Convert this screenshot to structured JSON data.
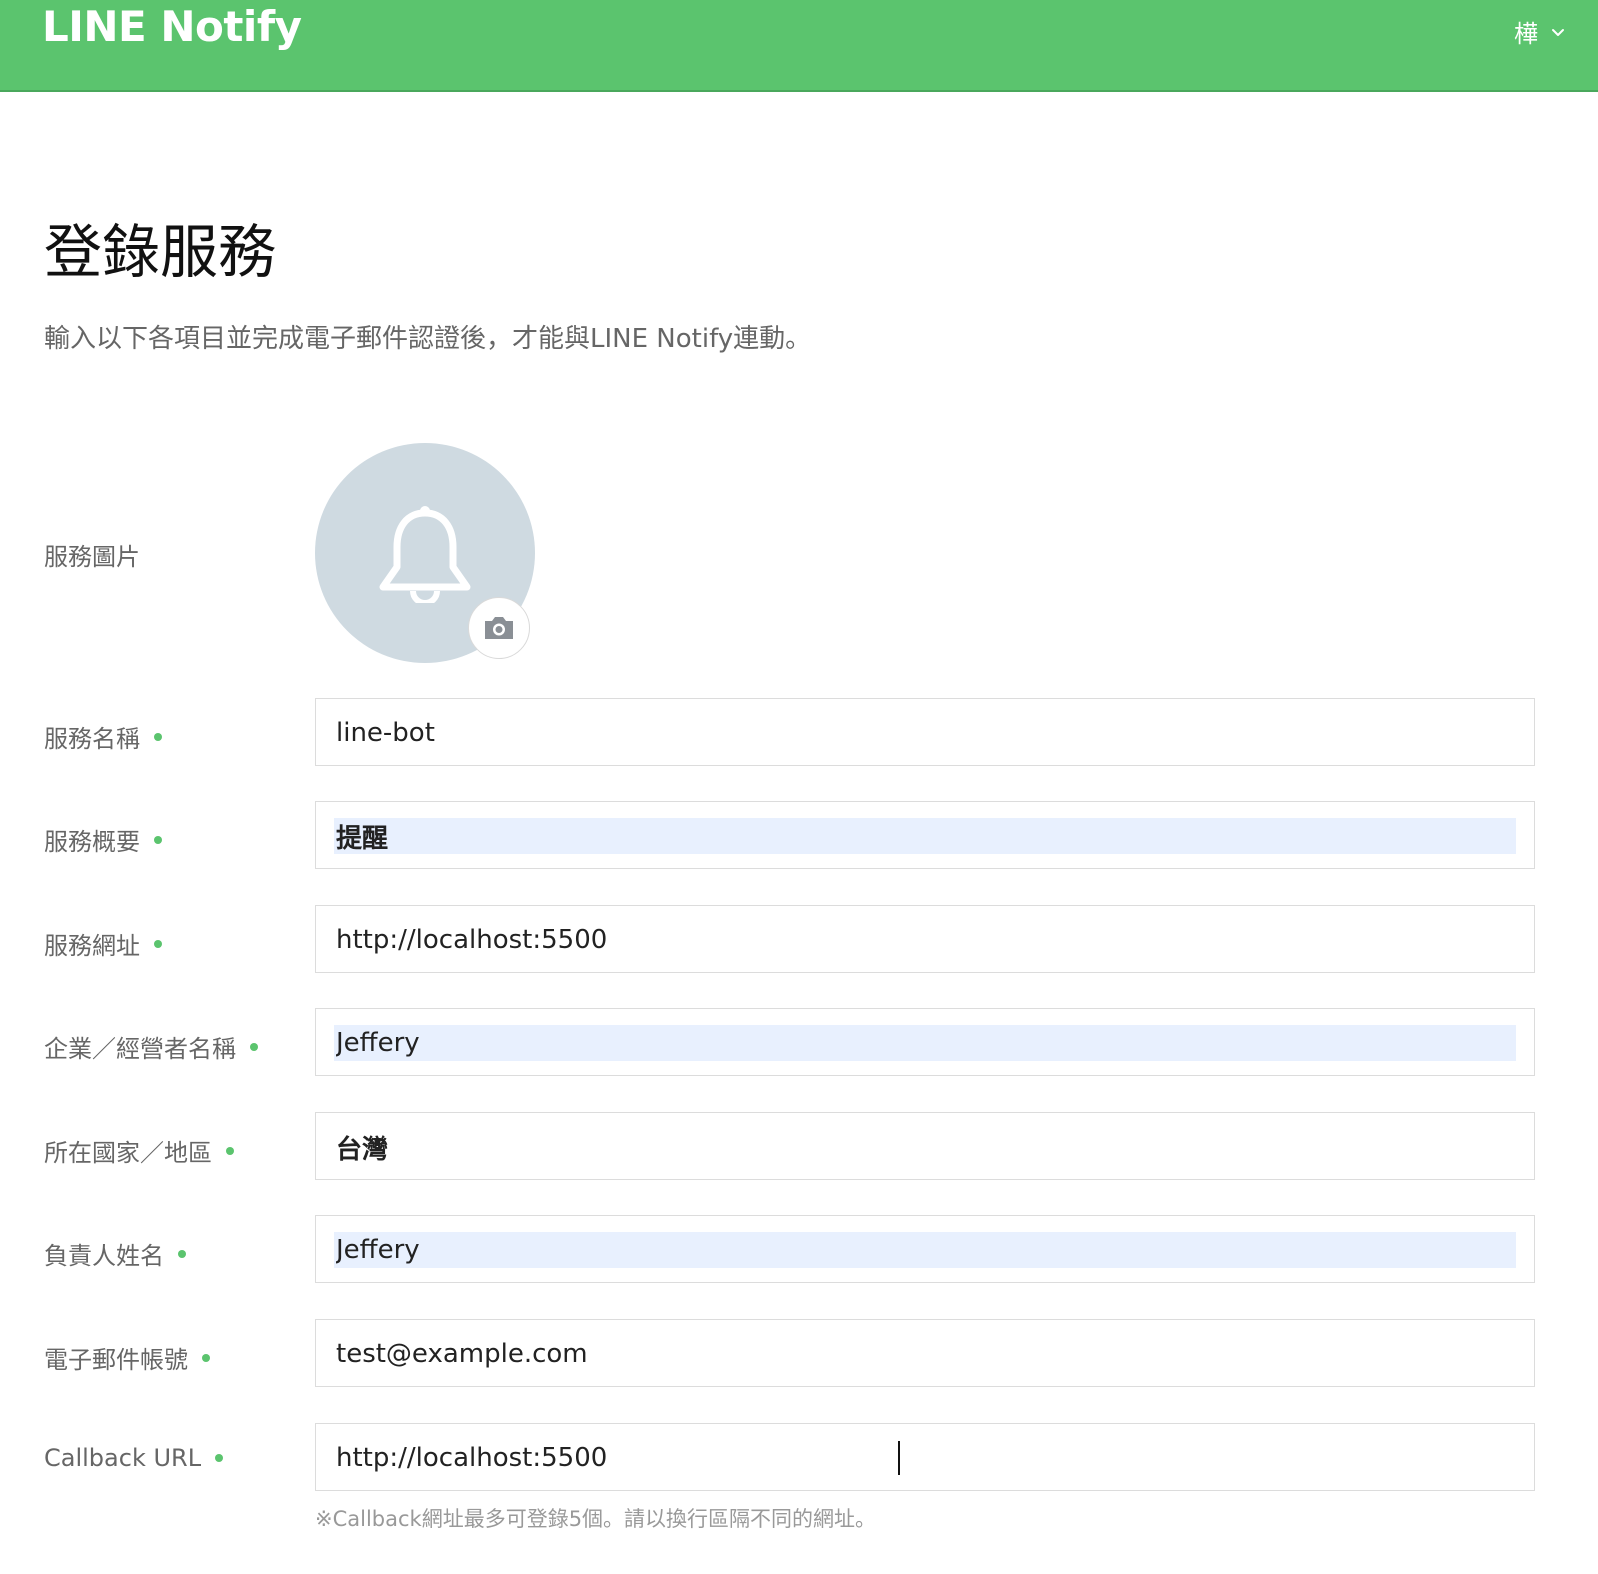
{
  "header": {
    "logo": "LINE Notify",
    "user_name": "樺",
    "brand_color": "#5bc46e"
  },
  "page": {
    "title": "登錄服務",
    "description": "輸入以下各項目並完成電子郵件認證後，才能與LINE Notify連動。"
  },
  "form": {
    "image_label": "服務圖片",
    "avatar_icon": "bell-icon",
    "camera_icon": "camera-icon",
    "fields": [
      {
        "label": "服務名稱",
        "value": "line-bot"
      },
      {
        "label": "服務概要",
        "value": "提醒"
      },
      {
        "label": "服務網址",
        "value": "http://localhost:5500"
      },
      {
        "label": "企業／經營者名稱",
        "value": "Jeffery"
      },
      {
        "label": "所在國家／地區",
        "value": "台灣"
      },
      {
        "label": "負責人姓名",
        "value": "Jeffery"
      },
      {
        "label": "電子郵件帳號",
        "value": "test@example.com"
      },
      {
        "label": "Callback URL",
        "value": "http://localhost:5500"
      }
    ],
    "callback_note": "※Callback網址最多可登錄5個。請以換行區隔不同的網址。"
  }
}
